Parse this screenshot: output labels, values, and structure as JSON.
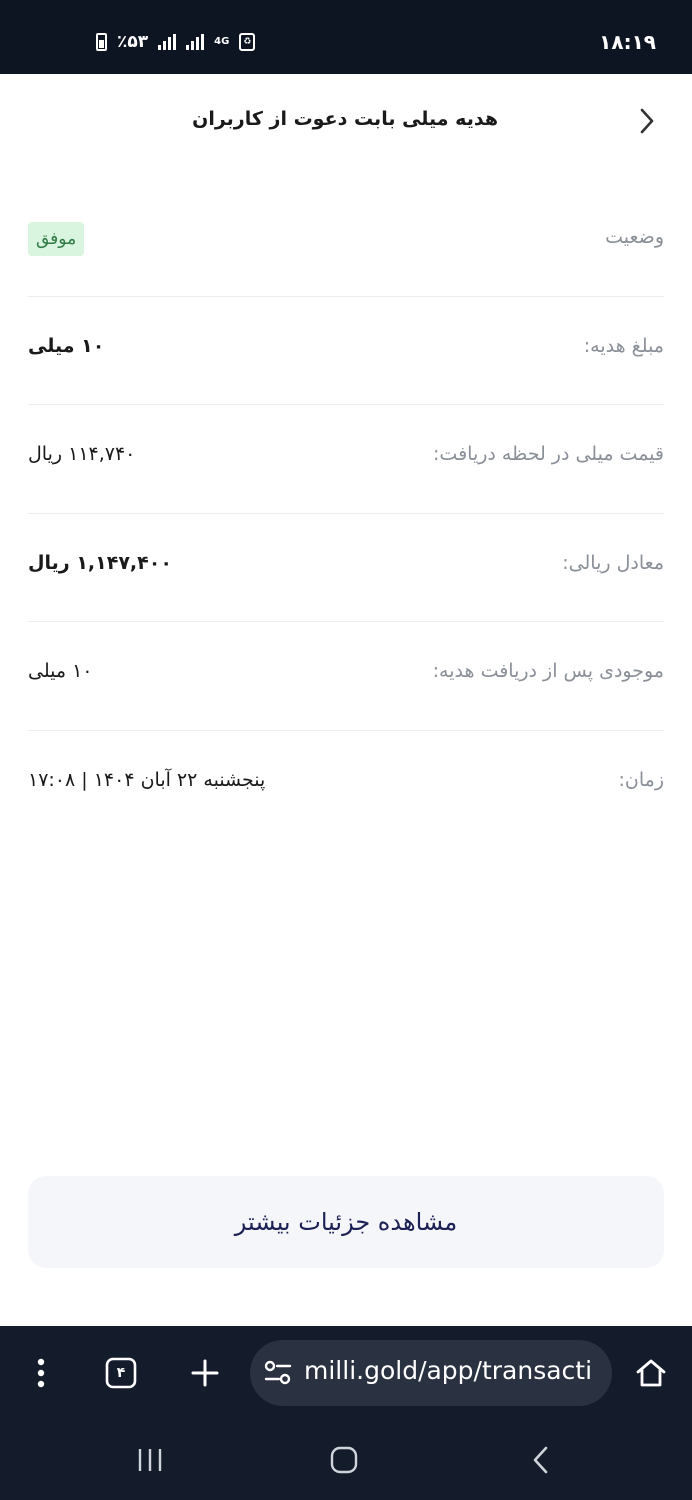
{
  "status_bar": {
    "time": "۱۸:۱۹",
    "battery": "٪۵۳",
    "network": "4G"
  },
  "header": {
    "title": "هدیه میلی بابت دعوت از کاربران",
    "back_icon": "chevron-right-icon"
  },
  "details": [
    {
      "label": "وضعیت",
      "value": "موفق"
    },
    {
      "label": "مبلغ هدیه:",
      "value": "۱۰ میلی"
    },
    {
      "label": "قیمت میلی در لحظه دریافت:",
      "value": "۱۱۴,۷۴۰ ریال"
    },
    {
      "label": "معادل ریالی:",
      "value": "۱,۱۴۷,۴۰۰ ریال"
    },
    {
      "label": "موجودی پس از دریافت هدیه:",
      "value": "۱۰ میلی"
    },
    {
      "label": "زمان:",
      "value": "پنجشنبه ۲۲ آبان ۱۴۰۴ | ۱۷:۰۸"
    }
  ],
  "more_button": "مشاهده جزئیات بیشتر",
  "browser": {
    "url": "milli.gold/app/transacti",
    "tab_count": "۴"
  },
  "colors": {
    "status_bg": "#0d1523",
    "browser_bg": "#141b2a",
    "badge_bg": "#d9f4df",
    "badge_text": "#2f7a44",
    "button_text": "#1c2155"
  }
}
